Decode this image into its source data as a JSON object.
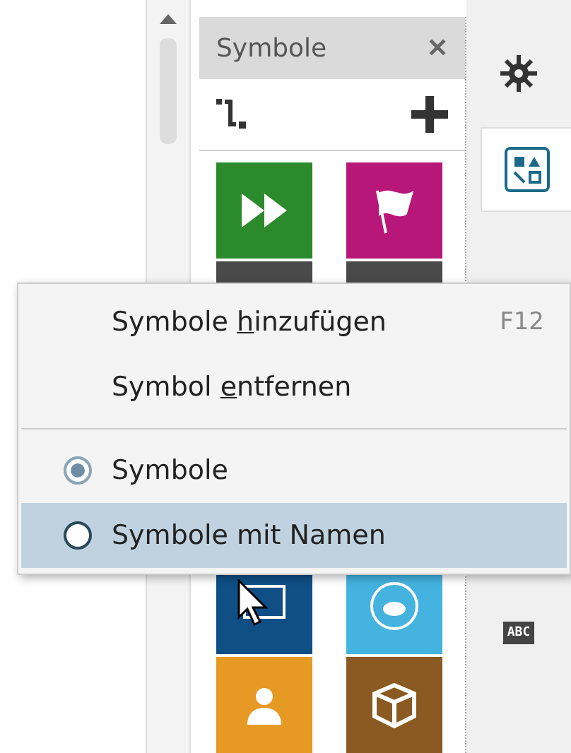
{
  "panel": {
    "title": "Symbole",
    "close": "✕"
  },
  "tiles": [
    {
      "kind": "fast-forward",
      "color": "#2b8a2b"
    },
    {
      "kind": "flag",
      "color": "#b8177a"
    },
    {
      "kind": "plain",
      "color": "#4a4a4a"
    },
    {
      "kind": "plain",
      "color": "#4a4a4a"
    },
    {
      "kind": "screen",
      "color": "#0f4f86"
    },
    {
      "kind": "disc",
      "color": "#45b3e0"
    },
    {
      "kind": "person",
      "color": "#e69a24"
    },
    {
      "kind": "box",
      "color": "#8a5a22"
    }
  ],
  "rail": {
    "abc": "ABC"
  },
  "menu": [
    {
      "kind": "action",
      "before": "Symbole ",
      "accel": "h",
      "after": "inzufügen",
      "shortcut": "F12",
      "highlighted": false
    },
    {
      "kind": "action",
      "before": "Symbol ",
      "accel": "e",
      "after": "ntfernen",
      "highlighted": false
    },
    {
      "kind": "separator"
    },
    {
      "kind": "radio",
      "before": "Symbole",
      "selected": true,
      "highlighted": false
    },
    {
      "kind": "radio",
      "before": "Symbole mit Namen",
      "selected": false,
      "highlighted": true
    }
  ]
}
